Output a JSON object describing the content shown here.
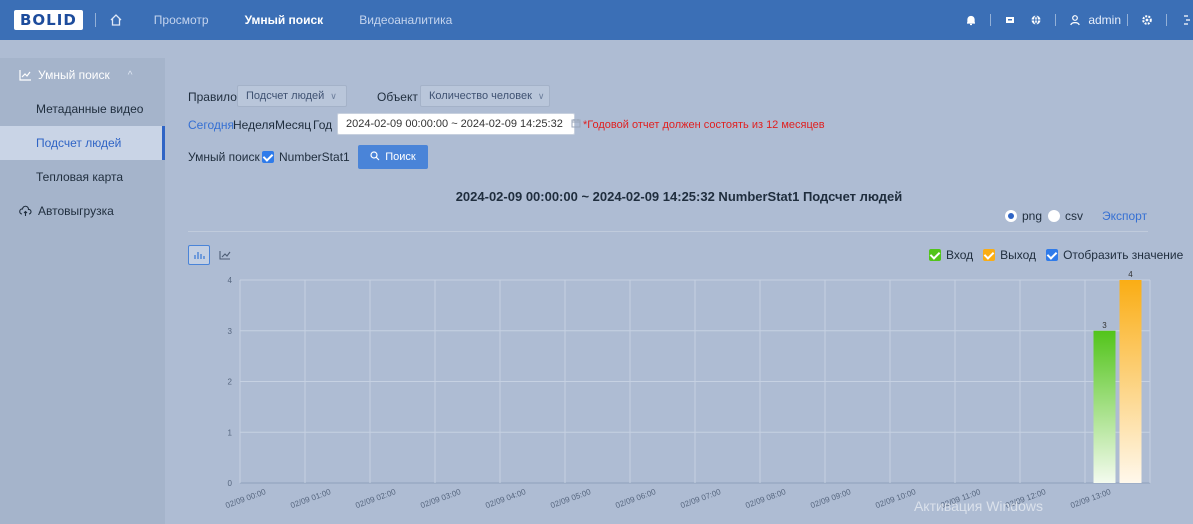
{
  "topbar": {
    "logo": "BOLID",
    "nav": [
      {
        "label": "Просмотр",
        "active": false
      },
      {
        "label": "Умный поиск",
        "active": true
      },
      {
        "label": "Видеоаналитика",
        "active": false
      }
    ],
    "user": "admin"
  },
  "sidebar": {
    "section": "Умный поиск",
    "items": [
      {
        "label": "Метаданные видео",
        "active": false
      },
      {
        "label": "Подсчет людей",
        "active": true
      },
      {
        "label": "Тепловая карта",
        "active": false
      }
    ],
    "auto_upload": "Автовыгрузка"
  },
  "filters": {
    "rule_label": "Правило",
    "rule_value": "Подсчет людей",
    "object_label": "Объект",
    "object_value": "Количество человек",
    "periods": [
      "Сегодня",
      "Неделя",
      "Месяц",
      "Год"
    ],
    "active_period": "Сегодня",
    "date_range": "2024-02-09 00:00:00 ~ 2024-02-09 14:25:32",
    "warning": "*Годовой отчет должен состоять из 12 месяцев",
    "smart_search_label": "Умный поиск",
    "channel": "NumberStat1",
    "search_button": "Поиск"
  },
  "chart_header": {
    "title": "2024-02-09 00:00:00 ~ 2024-02-09 14:25:32  NumberStat1  Подсчет людей",
    "format_png": "png",
    "format_csv": "csv",
    "export": "Экспорт",
    "legend_in": "Вход",
    "legend_out": "Выход",
    "legend_show_values": "Отобразить значение"
  },
  "colors": {
    "in": "#52c41a",
    "out": "#faad14",
    "accent": "#2f64c5",
    "topbar": "#3b6fb6"
  },
  "chart_data": {
    "type": "bar",
    "categories": [
      "02/09 00:00",
      "02/09 01:00",
      "02/09 02:00",
      "02/09 03:00",
      "02/09 04:00",
      "02/09 05:00",
      "02/09 06:00",
      "02/09 07:00",
      "02/09 08:00",
      "02/09 09:00",
      "02/09 10:00",
      "02/09 11:00",
      "02/09 12:00",
      "02/09 13:00"
    ],
    "series": [
      {
        "name": "Вход",
        "values": [
          0,
          0,
          0,
          0,
          0,
          0,
          0,
          0,
          0,
          0,
          0,
          0,
          0,
          3
        ]
      },
      {
        "name": "Выход",
        "values": [
          0,
          0,
          0,
          0,
          0,
          0,
          0,
          0,
          0,
          0,
          0,
          0,
          0,
          4
        ]
      }
    ],
    "ylim": [
      0,
      4
    ],
    "yticks": [
      "0",
      "1",
      "2",
      "3",
      "4"
    ],
    "grid": true,
    "legend": "top-right"
  },
  "watermark": "Активация Windows"
}
